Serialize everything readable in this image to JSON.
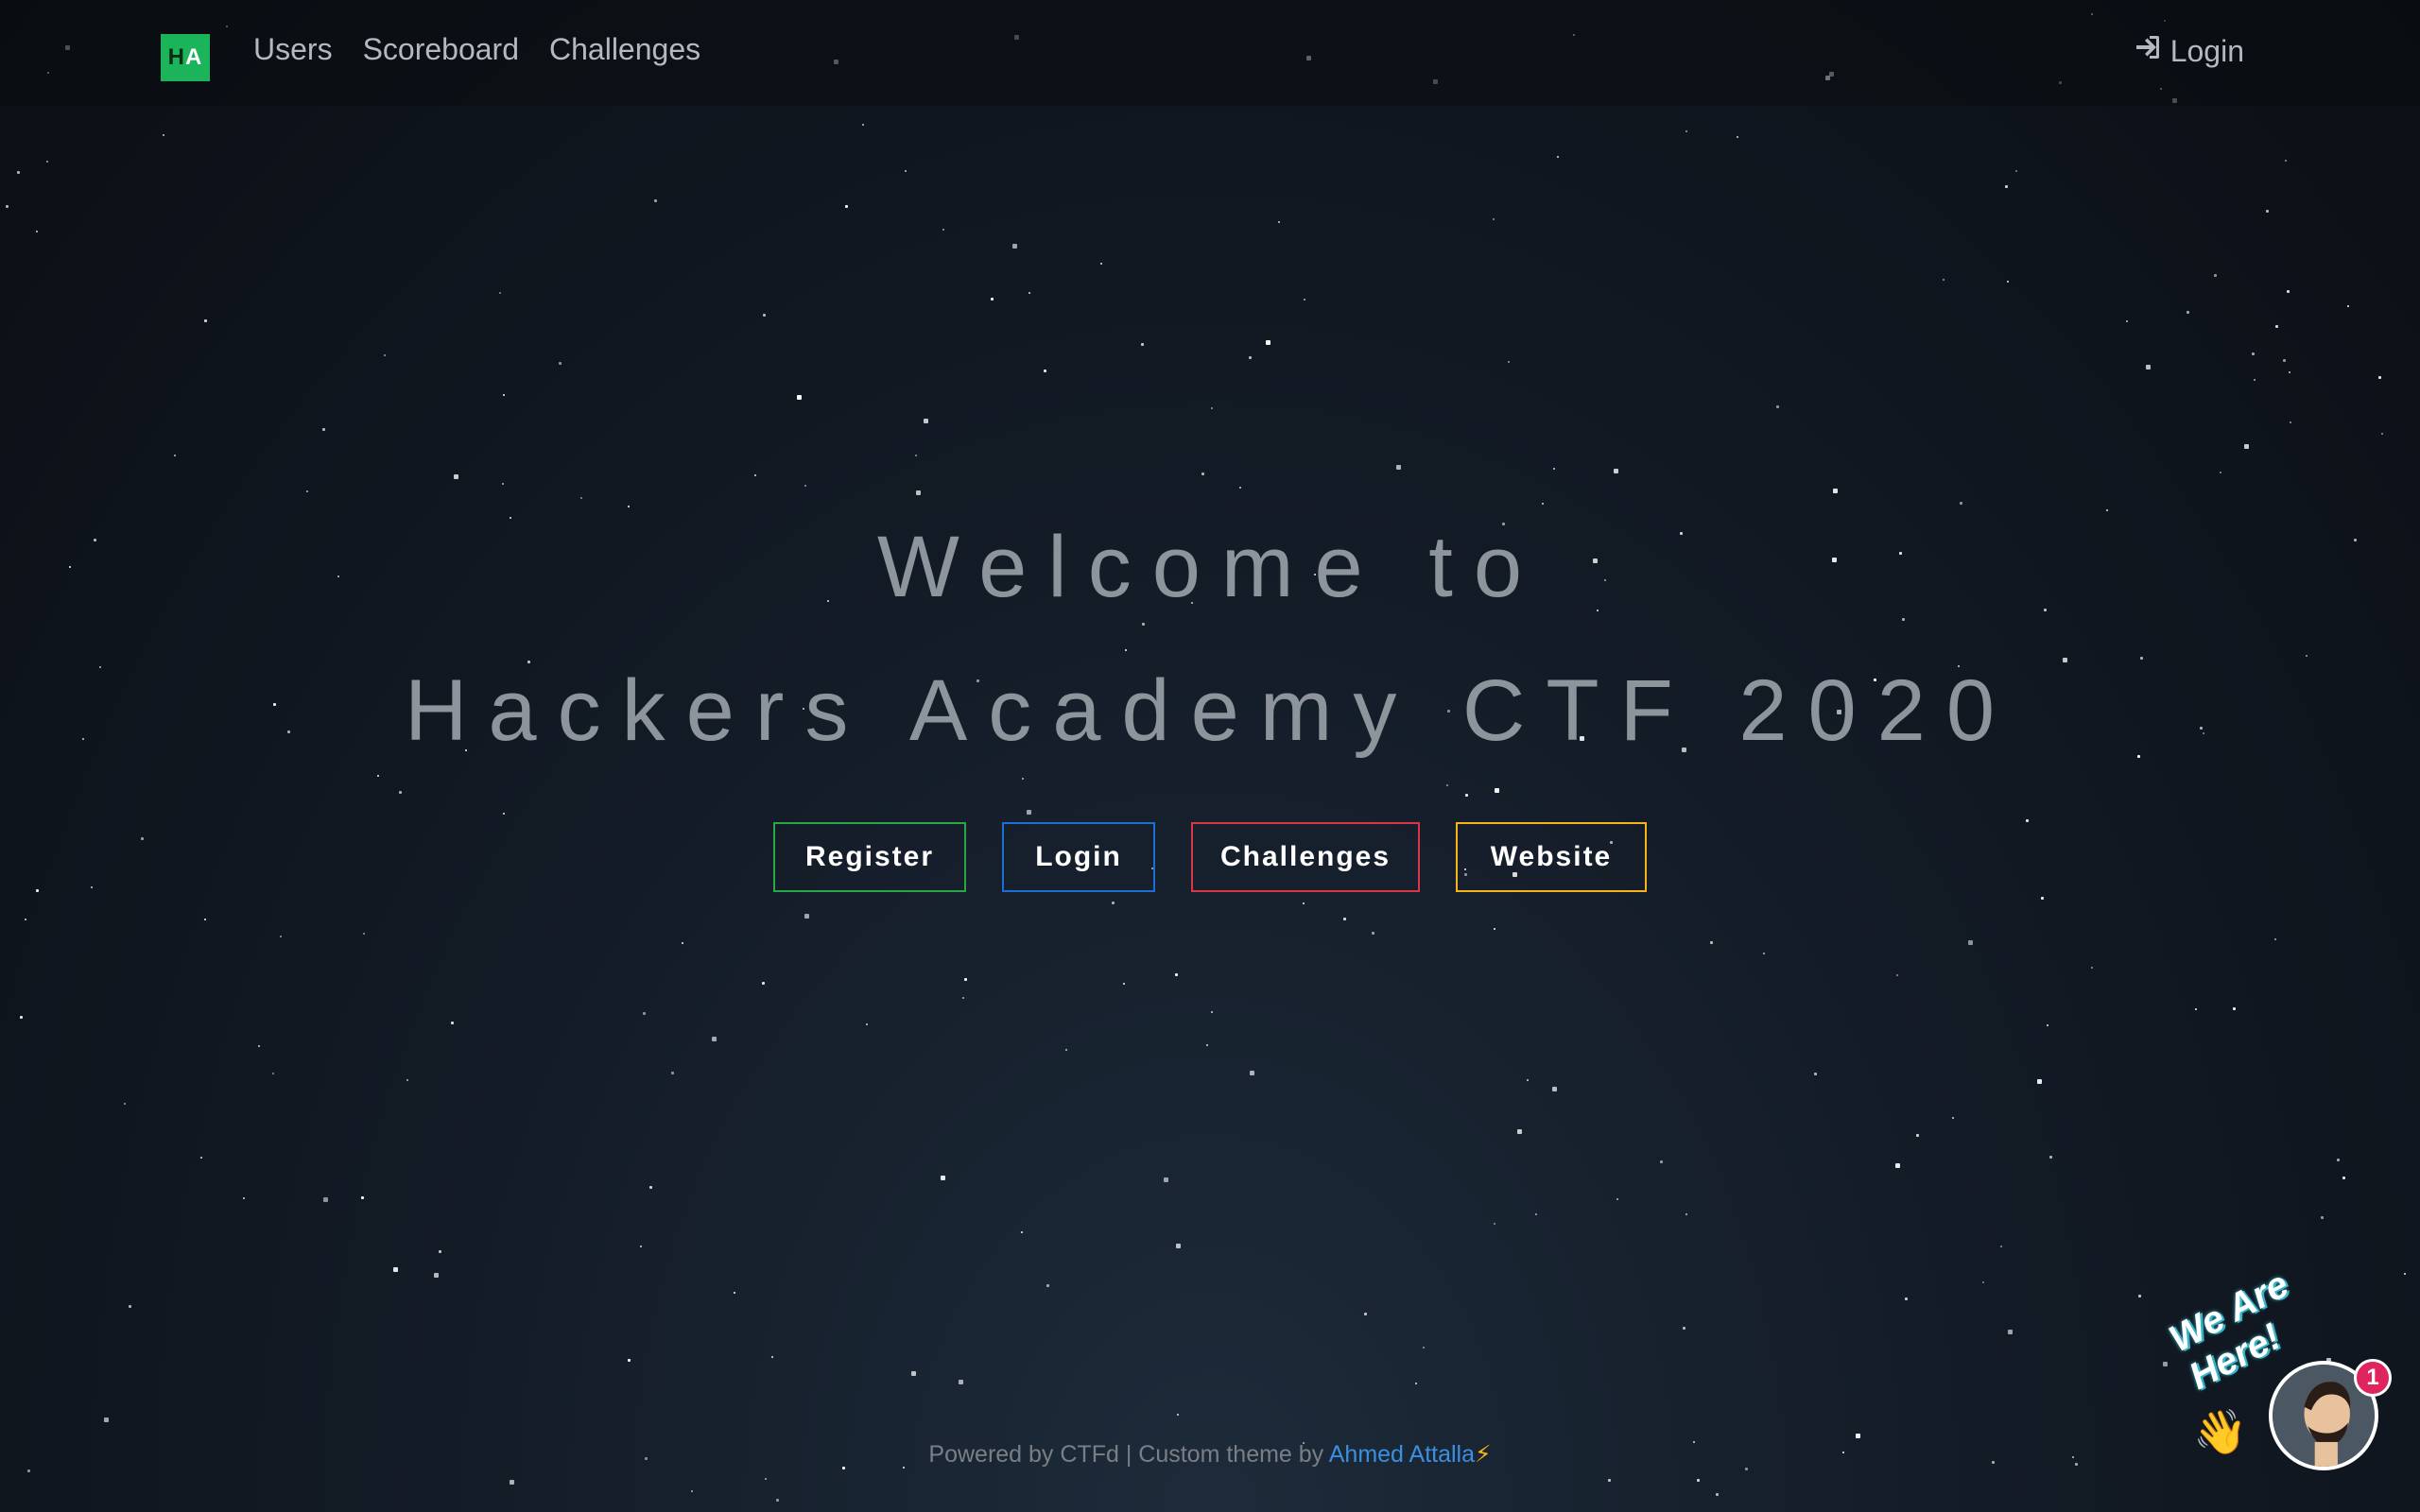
{
  "navbar": {
    "brand": {
      "letter1": "H",
      "letter2": "A"
    },
    "links": [
      "Users",
      "Scoreboard",
      "Challenges"
    ],
    "login": {
      "label": "Login",
      "icon": "sign-in-icon"
    }
  },
  "hero": {
    "line1": "Welcome to",
    "line2": "Hackers Academy CTF 2020"
  },
  "buttons": [
    {
      "label": "Register",
      "color": "#28a745"
    },
    {
      "label": "Login",
      "color": "#1b6ed6"
    },
    {
      "label": "Challenges",
      "color": "#dc3545"
    },
    {
      "label": "Website",
      "color": "#f4b41a"
    }
  ],
  "footer": {
    "powered": "Powered by CTFd",
    "separator": " | Custom theme by ",
    "author": "Ahmed Attalla",
    "bolt": "⚡"
  },
  "chat": {
    "text": "We Are Here!",
    "badge": "1",
    "wave": "👋"
  }
}
